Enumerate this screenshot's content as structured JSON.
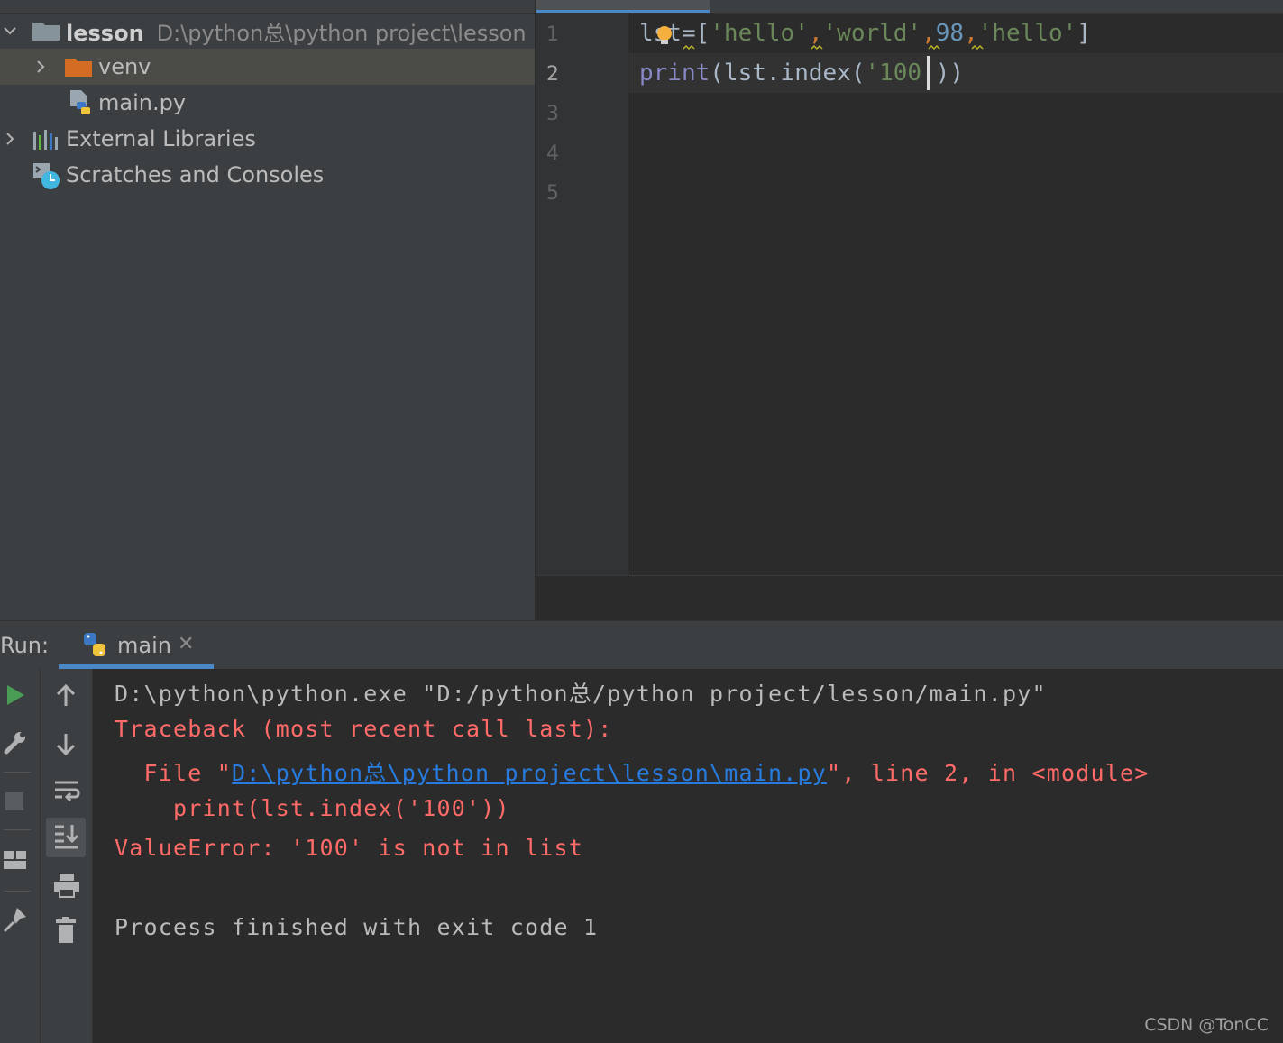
{
  "project": {
    "root": {
      "name": "lesson",
      "path": "D:\\python总\\python project\\lesson"
    },
    "items": [
      {
        "label": "venv"
      },
      {
        "label": "main.py"
      },
      {
        "label": "External Libraries"
      },
      {
        "label": "Scratches and Consoles"
      }
    ]
  },
  "editor": {
    "line_numbers": [
      "1",
      "2",
      "3",
      "4",
      "5"
    ],
    "code": {
      "l1_var": "lst",
      "l1_eq": "=[",
      "l1_s1": "'hello'",
      "l1_c1": ",",
      "l1_s2": "'world'",
      "l1_c2": ",",
      "l1_num": "98",
      "l1_c3": ",",
      "l1_s3": "'hello'",
      "l1_end": "]",
      "l2_fn": "print",
      "l2_mid": "(lst.index(",
      "l2_str": "'100'",
      "l2_end": "))"
    }
  },
  "run": {
    "title": "Run:",
    "tab_label": "main",
    "console": {
      "cmd": "D:\\python\\python.exe \"D:/python总/python project/lesson/main.py\"",
      "traceback": "Traceback (most recent call last):",
      "file_prefix": "  File \"",
      "file_link": "D:\\python总\\python project\\lesson\\main.py",
      "file_suffix": "\", line 2, in <module>",
      "code_line": "    print(lst.index('100'))",
      "error": "ValueError: '100' is not in list",
      "exit": "Process finished with exit code 1"
    }
  },
  "watermark": "CSDN @TonCC",
  "colors": {
    "accent": "#4a88c7",
    "error": "#ff6b68",
    "link": "#287bde",
    "run_green": "#499c54",
    "folder_orange": "#d46d23"
  }
}
